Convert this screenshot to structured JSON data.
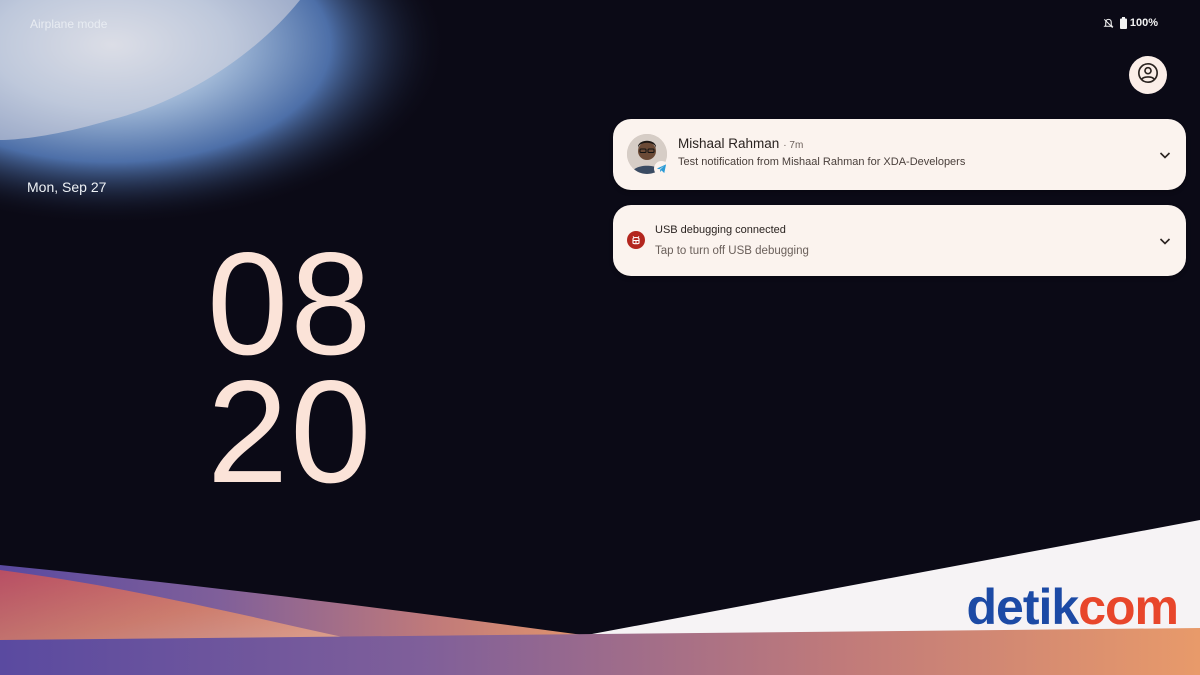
{
  "status_bar": {
    "left_text": "Airplane mode",
    "battery_text": "100%",
    "icons": [
      "notifications-off-icon",
      "battery-icon"
    ]
  },
  "lockscreen": {
    "date": "Mon, Sep 27",
    "clock_hour": "08",
    "clock_minute": "20",
    "user_icon": "account-circle-icon"
  },
  "notifications": [
    {
      "app_icon": "telegram-icon",
      "sender": "Mishaal Rahman",
      "time": "· 7m",
      "body": "Test notification from Mishaal Rahman for XDA-Developers",
      "expand_icon": "chevron-down-icon"
    },
    {
      "app_icon": "android-debug-icon",
      "title": "USB debugging connected",
      "body": "Tap to turn off USB debugging",
      "expand_icon": "chevron-down-icon"
    }
  ],
  "watermark": {
    "part1": "detik",
    "part2": "com"
  },
  "colors": {
    "clock": "#fbe3d8",
    "card": "#fbf3ee",
    "usb_icon": "#b3261e",
    "watermark_blue": "#1c4aa5",
    "watermark_orange": "#e8462b"
  }
}
